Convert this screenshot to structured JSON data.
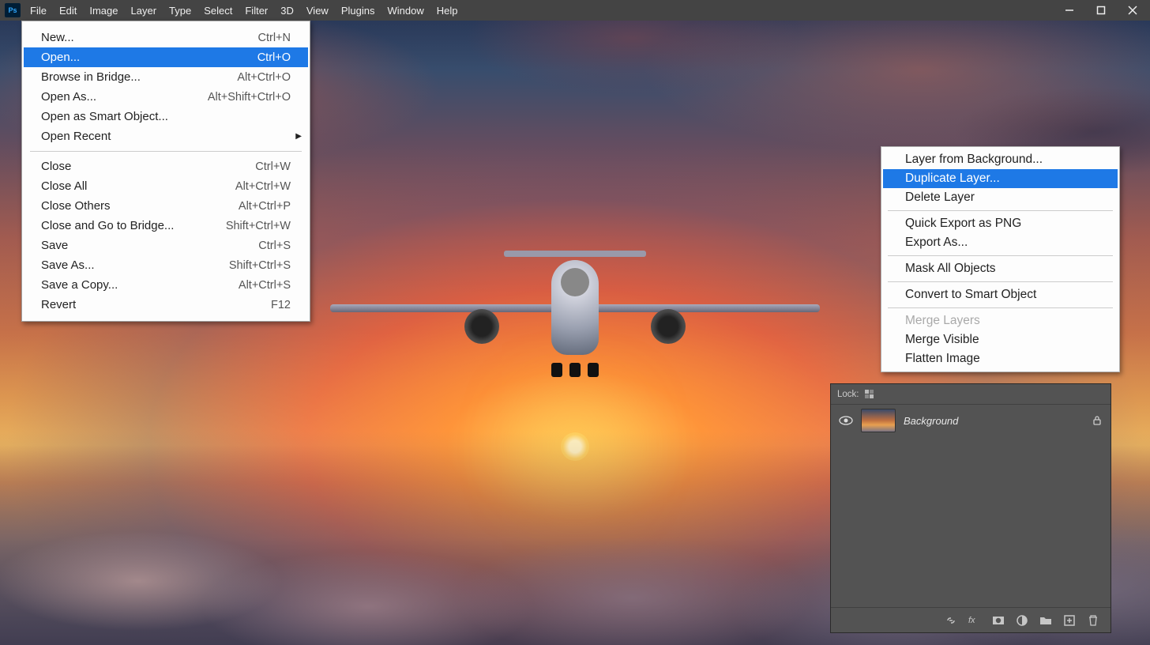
{
  "app": {
    "logo_text": "Ps"
  },
  "menubar": {
    "items": [
      "File",
      "Edit",
      "Image",
      "Layer",
      "Type",
      "Select",
      "Filter",
      "3D",
      "View",
      "Plugins",
      "Window",
      "Help"
    ]
  },
  "file_menu": {
    "groups": [
      [
        {
          "label": "New...",
          "shortcut": "Ctrl+N",
          "highlight": false
        },
        {
          "label": "Open...",
          "shortcut": "Ctrl+O",
          "highlight": true
        },
        {
          "label": "Browse in Bridge...",
          "shortcut": "Alt+Ctrl+O",
          "highlight": false
        },
        {
          "label": "Open As...",
          "shortcut": "Alt+Shift+Ctrl+O",
          "highlight": false
        },
        {
          "label": "Open as Smart Object...",
          "shortcut": "",
          "highlight": false
        },
        {
          "label": "Open Recent",
          "shortcut": "",
          "highlight": false,
          "submenu": true
        }
      ],
      [
        {
          "label": "Close",
          "shortcut": "Ctrl+W",
          "highlight": false
        },
        {
          "label": "Close All",
          "shortcut": "Alt+Ctrl+W",
          "highlight": false
        },
        {
          "label": "Close Others",
          "shortcut": "Alt+Ctrl+P",
          "highlight": false
        },
        {
          "label": "Close and Go to Bridge...",
          "shortcut": "Shift+Ctrl+W",
          "highlight": false
        },
        {
          "label": "Save",
          "shortcut": "Ctrl+S",
          "highlight": false
        },
        {
          "label": "Save As...",
          "shortcut": "Shift+Ctrl+S",
          "highlight": false
        },
        {
          "label": "Save a Copy...",
          "shortcut": "Alt+Ctrl+S",
          "highlight": false
        },
        {
          "label": "Revert",
          "shortcut": "F12",
          "highlight": false
        }
      ]
    ]
  },
  "context_menu": {
    "groups": [
      [
        {
          "label": "Layer from Background...",
          "highlight": false
        },
        {
          "label": "Duplicate Layer...",
          "highlight": true
        },
        {
          "label": "Delete Layer",
          "highlight": false
        }
      ],
      [
        {
          "label": "Quick Export as PNG",
          "highlight": false
        },
        {
          "label": "Export As...",
          "highlight": false
        }
      ],
      [
        {
          "label": "Mask All Objects",
          "highlight": false
        }
      ],
      [
        {
          "label": "Convert to Smart Object",
          "highlight": false
        }
      ],
      [
        {
          "label": "Merge Layers",
          "highlight": false,
          "disabled": true
        },
        {
          "label": "Merge Visible",
          "highlight": false
        },
        {
          "label": "Flatten Image",
          "highlight": false
        }
      ]
    ]
  },
  "layers_panel": {
    "lock_label": "Lock:",
    "layers": [
      {
        "name": "Background",
        "visible": true,
        "locked": true
      }
    ],
    "footer_icons": [
      "link",
      "fx",
      "mask",
      "adjustment",
      "group",
      "new",
      "trash"
    ]
  },
  "colors": {
    "menu_highlight": "#1e79e6",
    "panel_bg": "#535353",
    "menubar_bg": "#444444"
  }
}
